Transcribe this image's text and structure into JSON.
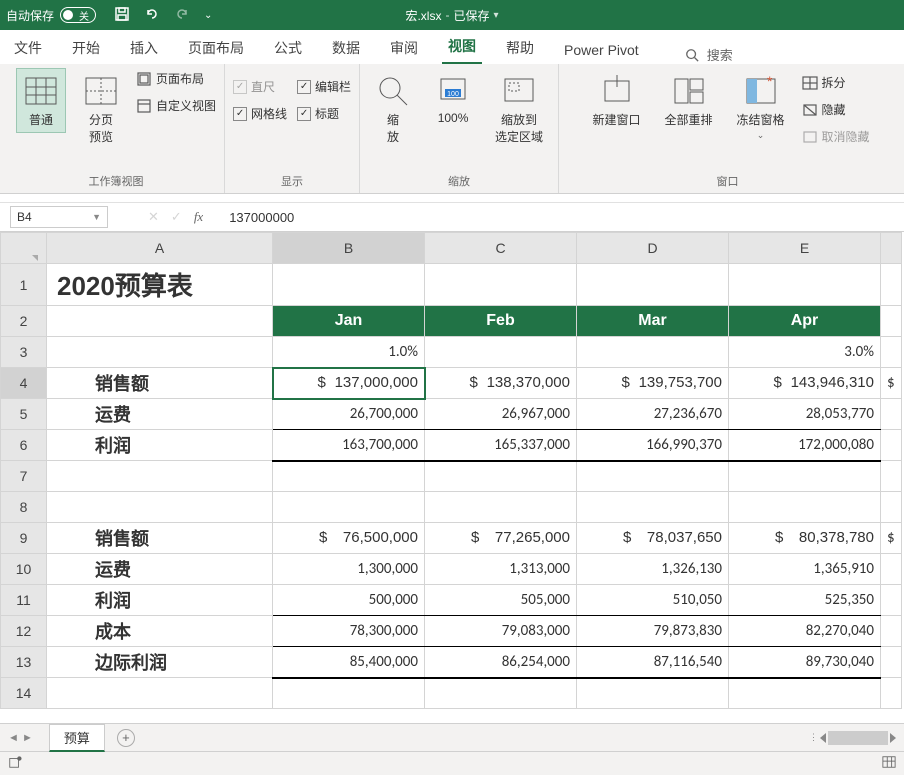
{
  "titlebar": {
    "autosave": "自动保存",
    "toggle_state": "关",
    "docname": "宏.xlsx",
    "saved": "已保存"
  },
  "tabs": {
    "items": [
      "文件",
      "开始",
      "插入",
      "页面布局",
      "公式",
      "数据",
      "审阅",
      "视图",
      "帮助",
      "Power Pivot"
    ],
    "active_index": 7,
    "search": "搜索"
  },
  "ribbon": {
    "group1": {
      "normal": "普通",
      "page_break": "分页\n预览",
      "page_layout": "页面布局",
      "custom_views": "自定义视图",
      "label": "工作簿视图"
    },
    "group2": {
      "ruler": "直尺",
      "formula_bar": "编辑栏",
      "gridlines": "网格线",
      "headings": "标题",
      "label": "显示"
    },
    "group3": {
      "zoom": "缩\n放",
      "hundred": "100%",
      "zoom_sel": "缩放到\n选定区域",
      "label": "缩放"
    },
    "group4": {
      "new_window": "新建窗口",
      "arrange": "全部重排",
      "freeze": "冻结窗格",
      "split": "拆分",
      "hide": "隐藏",
      "unhide": "取消隐藏",
      "label": "窗口"
    }
  },
  "namebox": "B4",
  "formula": "137000000",
  "columns": [
    "A",
    "B",
    "C",
    "D",
    "E"
  ],
  "cells": {
    "A1": "2020预算表",
    "months": [
      "Jan",
      "Feb",
      "Mar",
      "Apr"
    ],
    "B3": "1.0%",
    "E3": "3.0%",
    "A4": "销售额",
    "B4": "137,000,000",
    "C4": "138,370,000",
    "D4": "139,753,700",
    "E4": "143,946,310",
    "A5": "运费",
    "B5": "26,700,000",
    "C5": "26,967,000",
    "D5": "27,236,670",
    "E5": "28,053,770",
    "A6": "利润",
    "B6": "163,700,000",
    "C6": "165,337,000",
    "D6": "166,990,370",
    "E6": "172,000,080",
    "A9": "销售额",
    "B9": "76,500,000",
    "C9": "77,265,000",
    "D9": "78,037,650",
    "E9": "80,378,780",
    "A10": "运费",
    "B10": "1,300,000",
    "C10": "1,313,000",
    "D10": "1,326,130",
    "E10": "1,365,910",
    "A11": "利润",
    "B11": "500,000",
    "C11": "505,000",
    "D11": "510,050",
    "E11": "525,350",
    "A12": "成本",
    "B12": "78,300,000",
    "C12": "79,083,000",
    "D12": "79,873,830",
    "E12": "82,270,040",
    "A13": "边际利润",
    "B13": "85,400,000",
    "C13": "86,254,000",
    "D13": "87,116,540",
    "E13": "89,730,040",
    "dollar": "$"
  },
  "sheet_tab": "预算"
}
